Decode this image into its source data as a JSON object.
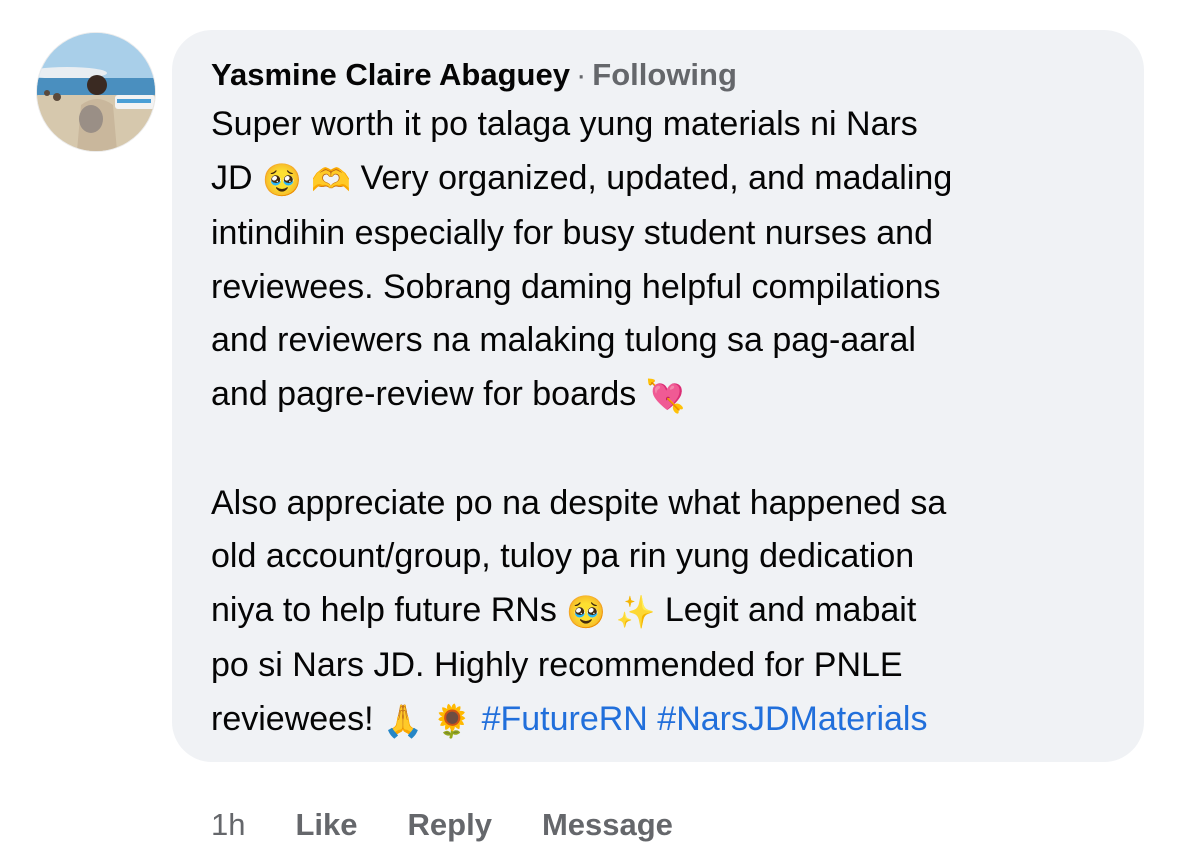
{
  "comment": {
    "author": "Yasmine Claire Abaguey",
    "separator": "·",
    "follow_status": "Following",
    "body_lines": [
      [
        "Super worth it po talaga yung materials ni Nars"
      ],
      [
        "JD ",
        "🥹",
        " ",
        "🫶",
        " Very organized, updated, and madaling"
      ],
      [
        "intindihin especially for busy student nurses and"
      ],
      [
        "reviewees. Sobrang daming helpful compilations"
      ],
      [
        "and reviewers na malaking tulong sa pag-aaral"
      ],
      [
        "and pagre-review for boards ",
        "💘"
      ],
      [
        "Also appreciate po na despite what happened sa"
      ],
      [
        "old account/group, tuloy pa rin yung dedication"
      ],
      [
        "niya to help future RNs ",
        "🥹",
        " ",
        "✨",
        " Legit and mabait"
      ],
      [
        "po si Nars JD. Highly recommended for PNLE"
      ],
      [
        "reviewees! ",
        "🙏",
        " ",
        "🌻",
        " "
      ]
    ],
    "hashtags": [
      "#FutureRN",
      "#NarsJDMaterials"
    ]
  },
  "actions": {
    "time": "1h",
    "like": "Like",
    "reply": "Reply",
    "message": "Message"
  },
  "icons": {
    "avatar": "profile-photo-beach"
  },
  "colors": {
    "bubble": "#f0f2f5",
    "text": "#050505",
    "secondary": "#65676b",
    "hashtag": "#216fdb"
  }
}
